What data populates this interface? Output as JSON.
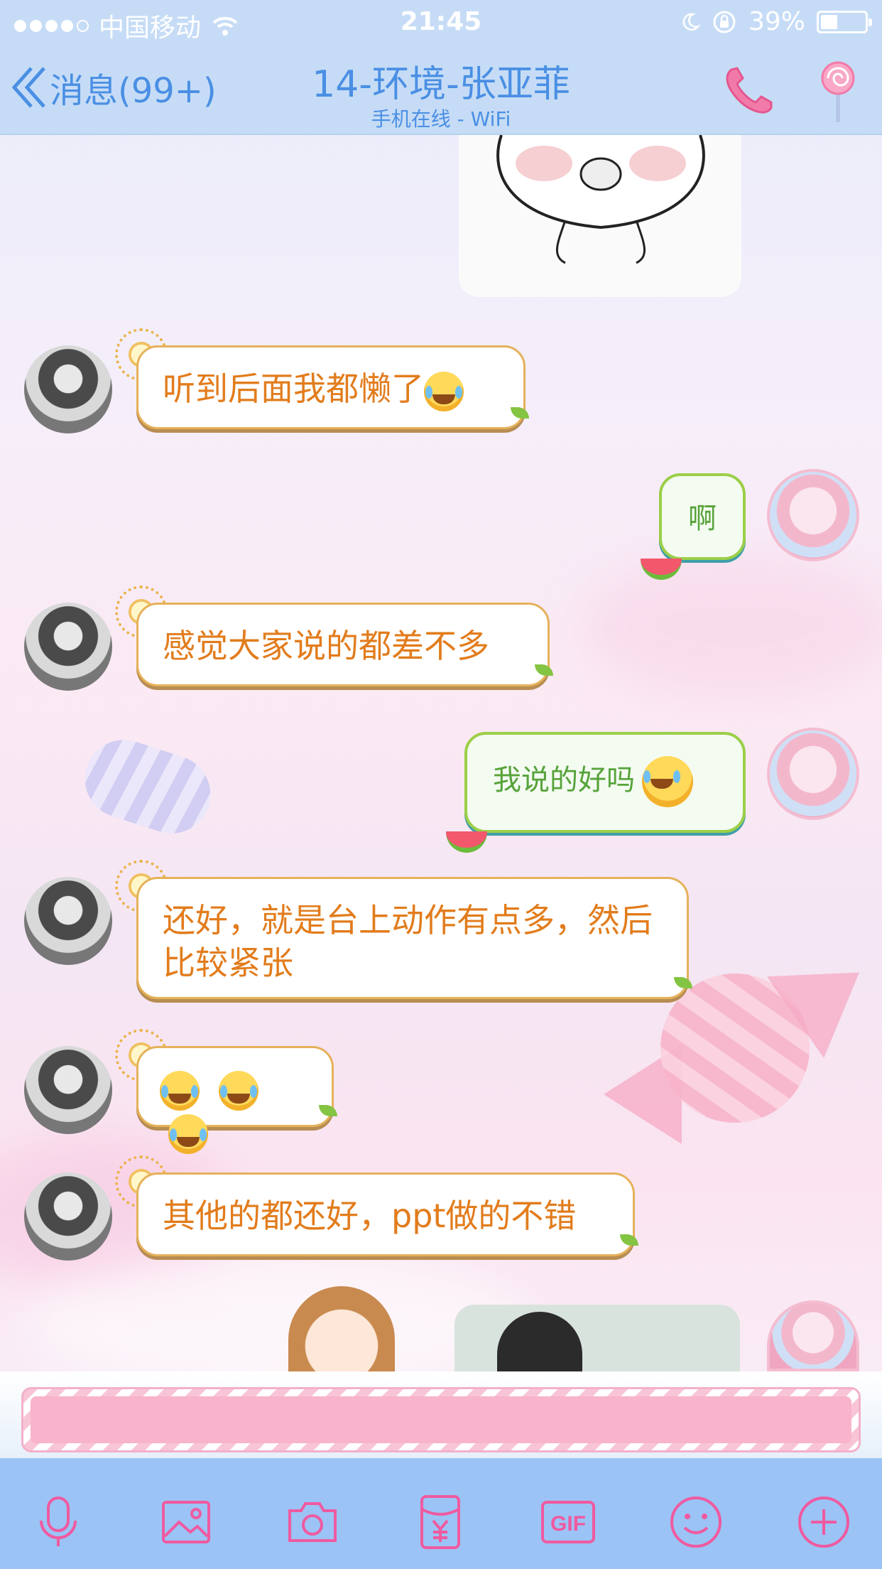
{
  "status_bar": {
    "carrier": "中国移动",
    "time": "21:45",
    "battery_pct": "39%",
    "battery_level": 0.39
  },
  "nav": {
    "back_label": "消息(99+)",
    "title": "14-环境-张亚菲",
    "subtitle": "手机在线 - WiFi"
  },
  "messages": [
    {
      "side": "left",
      "text": "听到后面我都懒了"
    },
    {
      "side": "right",
      "text": "啊"
    },
    {
      "side": "left",
      "text": "感觉大家说的都差不多"
    },
    {
      "side": "right",
      "text": "我说的好吗"
    },
    {
      "side": "left",
      "text": "还好，就是台上动作有点多，然后比较紧张"
    },
    {
      "side": "left",
      "text": ""
    },
    {
      "side": "left",
      "text": "其他的都还好，ppt做的不错"
    }
  ],
  "input": {
    "value": ""
  },
  "toolbar": {
    "gif_label": "GIF",
    "icons": [
      "microphone-icon",
      "image-icon",
      "camera-icon",
      "red-packet-icon",
      "gif-icon",
      "emoji-icon",
      "plus-icon"
    ]
  },
  "colors": {
    "nav_bg": "#c6dcf6",
    "nav_text": "#4a8fe4",
    "left_bubble_text": "#e27c1c",
    "right_bubble_text": "#56a33a",
    "toolbar_bg": "#9cc3f5",
    "toolbar_icon": "#ef5aa0"
  }
}
